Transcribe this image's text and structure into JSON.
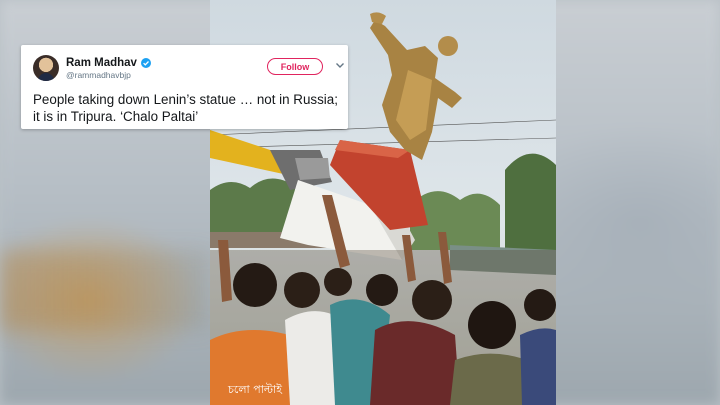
{
  "tweet": {
    "name": "Ram Madhav",
    "handle": "@rammadhavbjp",
    "follow_label": "Follow",
    "text": "People taking down Lenin’s statue … not in Russia; it is in Tripura. ‘Chalo Paltai’"
  },
  "photo": {
    "shirt_text": "চলো পাল্টাই"
  },
  "colors": {
    "follow": "#e0245e",
    "verified": "#1da1f2"
  }
}
